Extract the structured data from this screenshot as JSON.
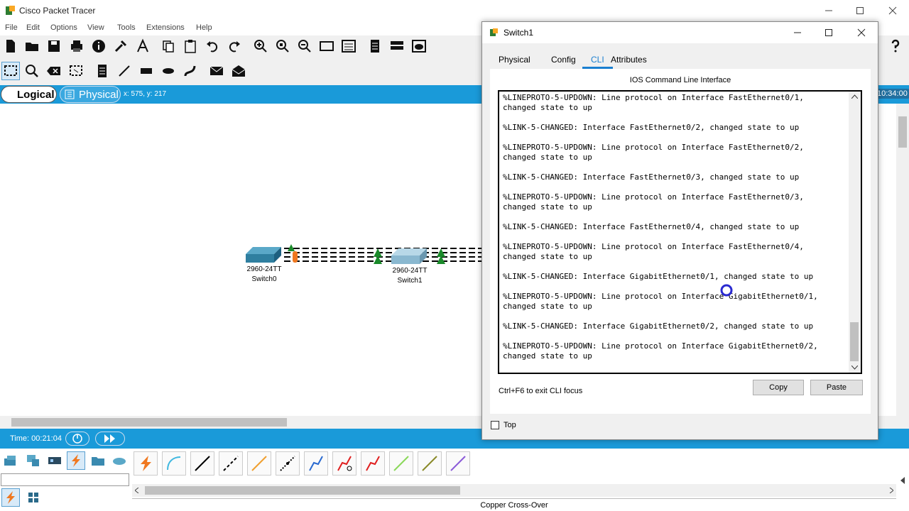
{
  "app": {
    "title": "Cisco Packet Tracer"
  },
  "menu": [
    "File",
    "Edit",
    "Options",
    "View",
    "Tools",
    "Extensions",
    "Help"
  ],
  "mode": {
    "logical": "Logical",
    "physical": "Physical",
    "coords": "x: 575, y: 217",
    "clock": "10:34:00"
  },
  "devices": [
    {
      "model": "2960-24TT",
      "name": "Switch0"
    },
    {
      "model": "2960-24TT",
      "name": "Switch1"
    }
  ],
  "timebar": {
    "time": "Time: 00:21:04"
  },
  "bottom": {
    "status": "Copper Cross-Over"
  },
  "dialog": {
    "title": "Switch1",
    "tabs": [
      "Physical",
      "Config",
      "CLI",
      "Attributes"
    ],
    "active_tab": "CLI",
    "panel_title": "IOS Command Line Interface",
    "console_lines": [
      "%LINEPROTO-5-UPDOWN: Line protocol on Interface FastEthernet0/1,",
      "changed state to up",
      "",
      "%LINK-5-CHANGED: Interface FastEthernet0/2, changed state to up",
      "",
      "%LINEPROTO-5-UPDOWN: Line protocol on Interface FastEthernet0/2,",
      "changed state to up",
      "",
      "%LINK-5-CHANGED: Interface FastEthernet0/3, changed state to up",
      "",
      "%LINEPROTO-5-UPDOWN: Line protocol on Interface FastEthernet0/3,",
      "changed state to up",
      "",
      "%LINK-5-CHANGED: Interface FastEthernet0/4, changed state to up",
      "",
      "%LINEPROTO-5-UPDOWN: Line protocol on Interface FastEthernet0/4,",
      "changed state to up",
      "",
      "%LINK-5-CHANGED: Interface GigabitEthernet0/1, changed state to up",
      "",
      "%LINEPROTO-5-UPDOWN: Line protocol on Interface GigabitEthernet0/1,",
      "changed state to up",
      "",
      "%LINK-5-CHANGED: Interface GigabitEthernet0/2, changed state to up",
      "",
      "%LINEPROTO-5-UPDOWN: Line protocol on Interface GigabitEthernet0/2,",
      "changed state to up"
    ],
    "hint": "Ctrl+F6 to exit CLI focus",
    "copy_label": "Copy",
    "paste_label": "Paste",
    "top_label": "Top"
  },
  "colors": {
    "accent": "#1a9ad9",
    "tab_active": "#1a7fd0",
    "link_up": "#1a8a2a",
    "link_pending": "#f07820"
  }
}
